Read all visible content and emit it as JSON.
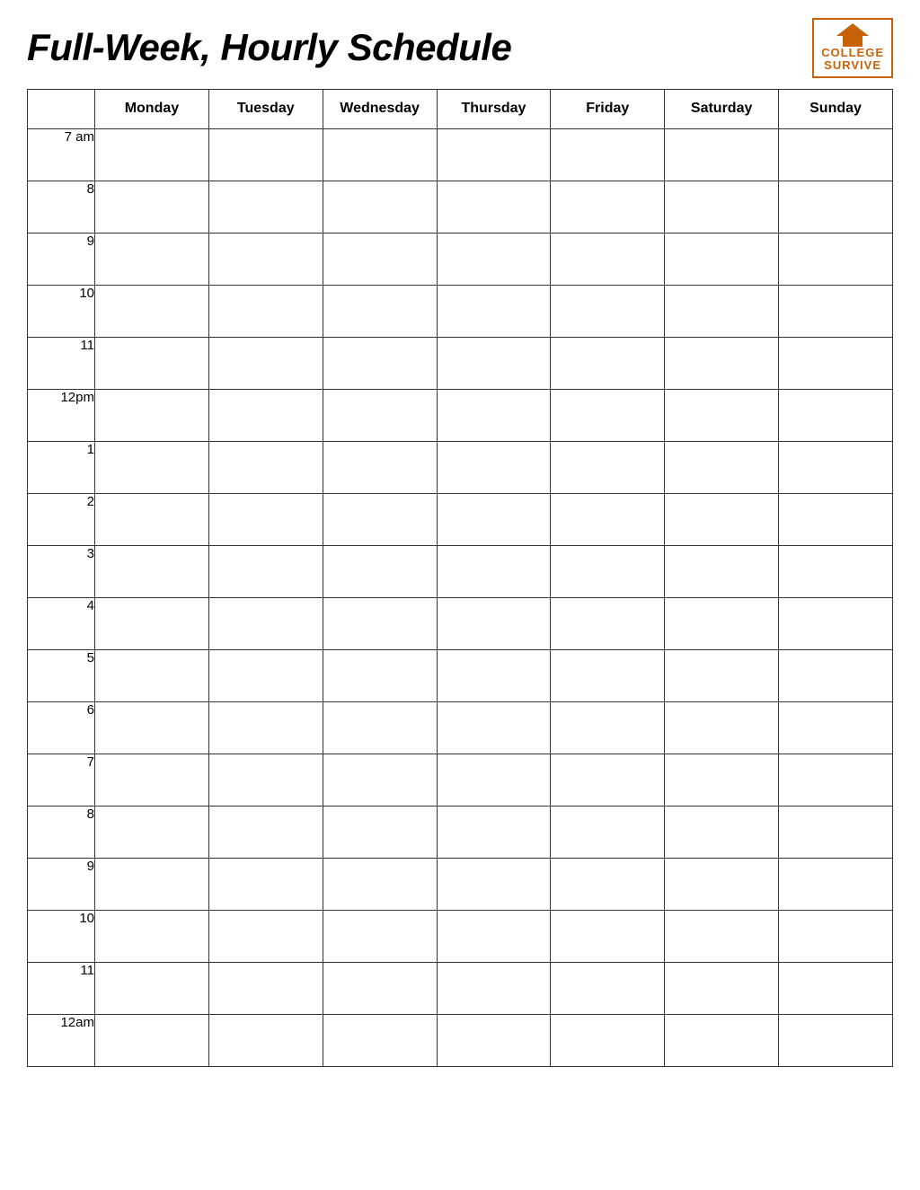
{
  "header": {
    "title": "Full-Week, Hourly Schedule",
    "logo": {
      "line1": "COLLEGE",
      "line2": "SURVIVE"
    }
  },
  "table": {
    "days": [
      "Monday",
      "Tuesday",
      "Wednesday",
      "Thursday",
      "Friday",
      "Saturday",
      "Sunday"
    ],
    "times": [
      "7 am",
      "8",
      "9",
      "10",
      "11",
      "12pm",
      "1",
      "2",
      "3",
      "4",
      "5",
      "6",
      "7",
      "8",
      "9",
      "10",
      "11",
      "12am"
    ]
  }
}
